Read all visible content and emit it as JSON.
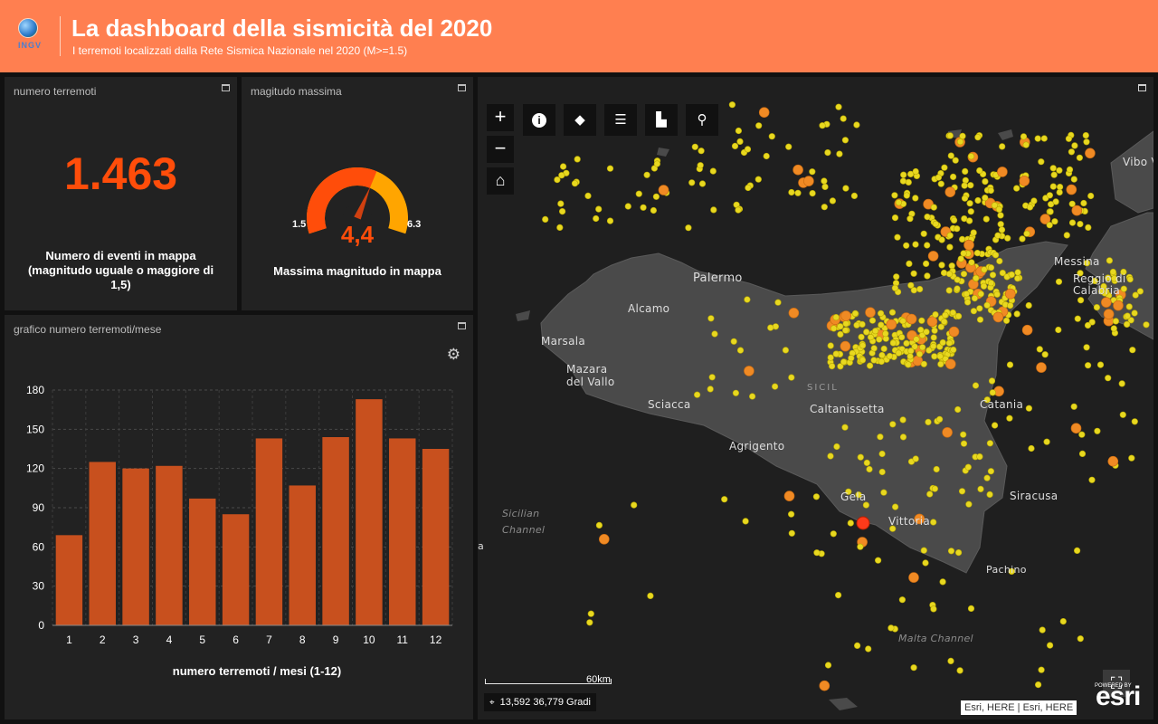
{
  "header": {
    "title": "La dashboard della sismicità del 2020",
    "subtitle": "I terremoti localizzati dalla Rete Sismica Nazionale nel 2020 (M>=1.5)",
    "logo_text": "INGV"
  },
  "count_panel": {
    "title": "numero terremoti",
    "value": "1.463",
    "description": "Numero di eventi in mappa (magnitudo uguale o maggiore di 1,5)"
  },
  "magnitude_panel": {
    "title": "magitudo massima",
    "value": "4,4",
    "min_label": "1.5",
    "max_label": "6.3",
    "gauge_min": 1.5,
    "gauge_max": 6.3,
    "gauge_value": 4.4,
    "description": "Massima magnitudo in mappa"
  },
  "chart_panel": {
    "title": "grafico numero terremoti/mese"
  },
  "chart_data": {
    "type": "bar",
    "categories": [
      "1",
      "2",
      "3",
      "4",
      "5",
      "6",
      "7",
      "8",
      "9",
      "10",
      "11",
      "12"
    ],
    "values": [
      69,
      125,
      120,
      122,
      97,
      85,
      143,
      107,
      144,
      173,
      143,
      135
    ],
    "title": "",
    "xlabel": "numero terremoti / mesi (1-12)",
    "ylabel": "",
    "ylim": [
      0,
      180
    ],
    "yticks": [
      0,
      30,
      60,
      90,
      120,
      150,
      180
    ],
    "grid": true,
    "bar_color": "#c8501e"
  },
  "map": {
    "labels": {
      "palermo": "Palermo",
      "alcamo": "Alcamo",
      "marsala": "Marsala",
      "mazara1": "Mazara",
      "mazara2": "del Vallo",
      "sciacca": "Sciacca",
      "caltanissetta": "Caltanissetta",
      "sicilia": "SICIL",
      "agrigento": "Agrigento",
      "gela": "Gela",
      "vittoria": "Vittoria",
      "catania": "Catania",
      "siracusa": "Siracusa",
      "pachino": "Pachino",
      "messina": "Messina",
      "reggio1": "Reggio di",
      "reggio2": "Calabria",
      "vibo": "Vibo Val",
      "sicilian1": "Sicilian",
      "sicilian2": "Channel",
      "malta": "Malta Channel",
      "cut": "a"
    },
    "zoom_in": "+",
    "zoom_out": "−",
    "scale_label": "60km",
    "coordinates": "13,592 36,779 Gradi",
    "attribution": "Esri, HERE | Esri, HERE",
    "powered_by": "POWERED BY",
    "esri_logo": "esri",
    "colors": {
      "land": "#4a4a4a",
      "sea": "#1f1f1f",
      "small_quake": "#e8d820",
      "large_quake": "#f08a24",
      "max_quake": "#ff3a1a"
    }
  }
}
